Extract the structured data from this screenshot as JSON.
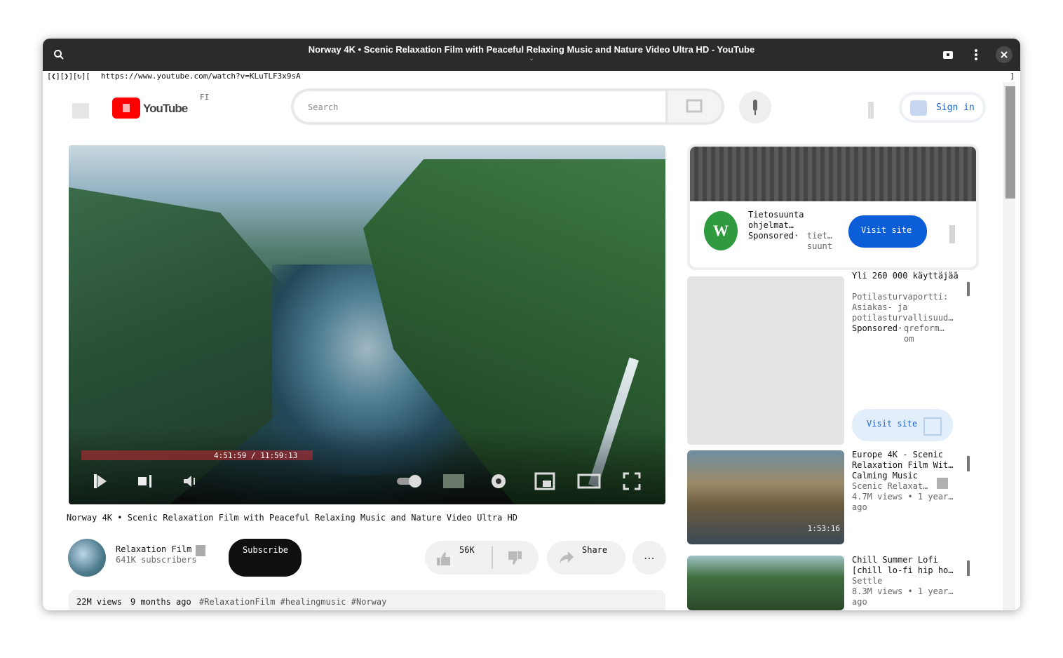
{
  "window": {
    "title": "Norway 4K • Scenic Relaxation Film with Peaceful Relaxing Music and Nature Video Ultra HD - YouTube",
    "caret": "⌄"
  },
  "browser": {
    "nav": "[❮][❯][↻][",
    "url": "https://www.youtube.com/watch?v=KLuTLF3x9sA",
    "url_end": "]"
  },
  "header": {
    "logo_text": "YouTube",
    "region": "FI",
    "search_placeholder": "Search",
    "sign_in": "Sign in"
  },
  "player": {
    "time": "4:51:59 / 11:59:13",
    "progress_fraction": 0.405
  },
  "video": {
    "title": "Norway 4K • Scenic Relaxation Film with Peaceful Relaxing Music and Nature Video Ultra HD",
    "channel": "Relaxation Film",
    "subscribers": "641K subscribers",
    "subscribe_label": "Subscribe",
    "likes": "56K",
    "share_label": "Share",
    "more_label": "⋯",
    "views": "22M views",
    "age": "9 months ago",
    "tags": "#RelaxationFilm #healingmusic #Norway"
  },
  "ad1": {
    "icon_letter": "W",
    "title": "Tietosuunta ohjelmat…",
    "sponsored": "Sponsored·",
    "domain": "tiet…suunt",
    "visit_label": "Visit site"
  },
  "ad2": {
    "headline": "Yli 260 000 käyttäjää",
    "description": "Potilasturvaportti: Asiakas- ja potilasturvallisuud…",
    "sponsored": "Sponsored·",
    "domain": "qreform…om",
    "visit_label": "Visit site"
  },
  "recommendations": [
    {
      "title": "Europe 4K - Scenic Relaxation Film Wit… Calming Music",
      "channel": "Scenic Relaxat…",
      "meta": "4.7M views • 1 year… ago",
      "duration": "1:53:16"
    },
    {
      "title": "Chill Summer Lofi [chill lo-fi hip ho…",
      "channel": "Settle",
      "meta": "8.3M views • 1 year… ago"
    }
  ]
}
